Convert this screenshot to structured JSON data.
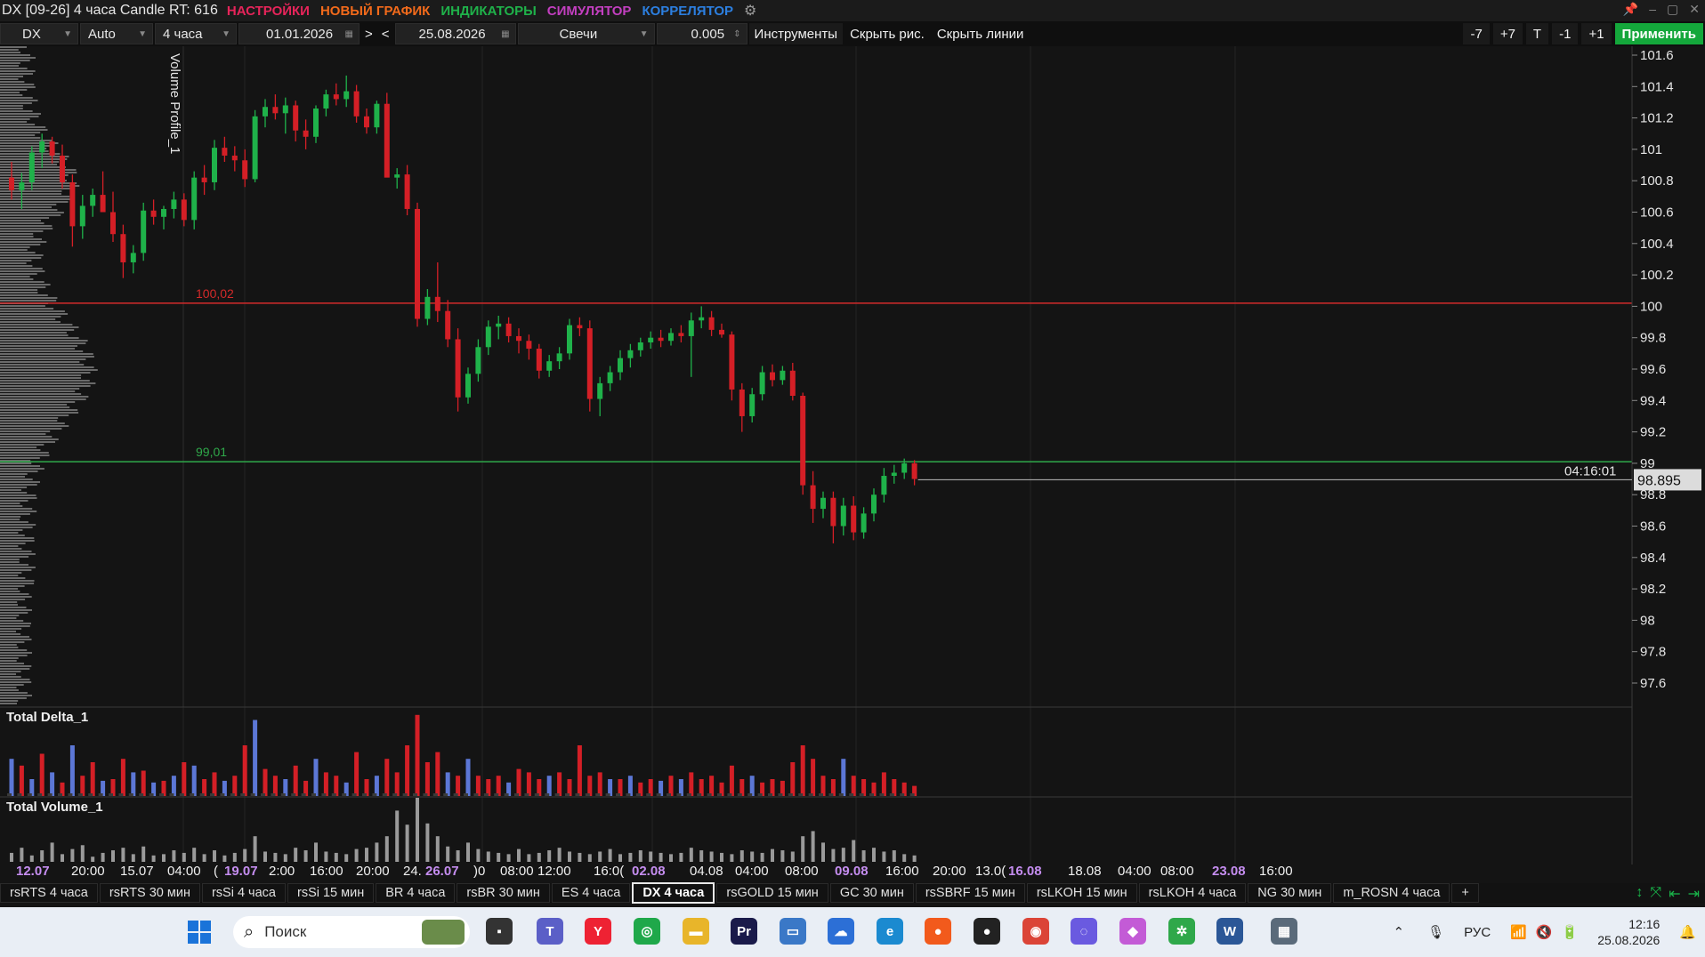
{
  "window": {
    "title": "DX [09-26] 4 часа Candle RT: 616",
    "menu": [
      {
        "label": "НАСТРОЙКИ",
        "color": "#e6245a"
      },
      {
        "label": "НОВЫЙ ГРАФИК",
        "color": "#f26a1b"
      },
      {
        "label": "ИНДИКАТОРЫ",
        "color": "#1fb24a"
      },
      {
        "label": "СИМУЛЯТОР",
        "color": "#c33fc0"
      },
      {
        "label": "КОРРЕЛЯТОР",
        "color": "#2c7fe0"
      }
    ]
  },
  "toolbar": {
    "symbol": "DX",
    "scale": "Auto",
    "timeframe": "4 часа",
    "date_from": "01.01.2026",
    "nav_next": ">",
    "nav_prev": "<",
    "date_to": "25.08.2026",
    "chart_type": "Свечи",
    "step": "0.005",
    "tools": "Инструменты",
    "hide_drawings": "Скрыть рис.",
    "hide_lines": "Скрыть линии",
    "right_buttons": [
      "-7",
      "+7",
      "T",
      "-1",
      "+1"
    ],
    "apply": "Применить"
  },
  "chart_data": {
    "type": "candlestick",
    "y_ticks": [
      "101.6",
      "101.4",
      "101.2",
      "101",
      "100.8",
      "100.6",
      "100.4",
      "100.2",
      "100",
      "99.8",
      "99.6",
      "99.4",
      "99.2",
      "99",
      "98.8",
      "98.6",
      "98.4",
      "98.2",
      "98",
      "97.8",
      "97.6"
    ],
    "ylim": [
      97.5,
      101.7
    ],
    "x_labels": [
      {
        "text": "12.07",
        "highlight": true
      },
      {
        "text": "20:00"
      },
      {
        "text": "15.07"
      },
      {
        "text": "04:00"
      },
      {
        "text": "("
      },
      {
        "text": "19.07",
        "highlight": true
      },
      {
        "text": "2:00"
      },
      {
        "text": "16:00"
      },
      {
        "text": "20:00"
      },
      {
        "text": "24."
      },
      {
        "text": "26.07",
        "highlight": true
      },
      {
        "text": ")0"
      },
      {
        "text": "08:00"
      },
      {
        "text": "12:00"
      },
      {
        "text": "16:0("
      },
      {
        "text": "02.08",
        "highlight": true
      },
      {
        "text": "04.08"
      },
      {
        "text": "04:00"
      },
      {
        "text": "08:00"
      },
      {
        "text": "09.08",
        "highlight": true
      },
      {
        "text": "16:00"
      },
      {
        "text": "20:00"
      },
      {
        "text": "13.0("
      },
      {
        "text": "16.08",
        "highlight": true
      },
      {
        "text": "18.08"
      },
      {
        "text": "04:00"
      },
      {
        "text": "08:00"
      },
      {
        "text": "23.08",
        "highlight": true
      },
      {
        "text": "16:00"
      }
    ],
    "levels": [
      {
        "label": "100,02",
        "price": 100.02,
        "color": "#d42a2a"
      },
      {
        "label": "99,01",
        "price": 99.01,
        "color": "#2fa84a"
      }
    ],
    "last_price": "98.895",
    "last_value": 98.895,
    "countdown": "04:16:01",
    "panels": {
      "volume_profile": "Volume Profile_1",
      "delta": "Total Delta_1",
      "volume": "Total Volume_1"
    },
    "colors": {
      "up": "#1fb24a",
      "down": "#d41f26",
      "delta_pos": "#5c77d6",
      "delta_neg": "#d41f26",
      "volume": "#9a9a9a"
    },
    "candles": [
      [
        100.82,
        100.92,
        100.68,
        100.74
      ],
      [
        100.74,
        100.85,
        100.62,
        100.79
      ],
      [
        100.79,
        101.02,
        100.74,
        100.98
      ],
      [
        100.98,
        101.1,
        100.88,
        101.05
      ],
      [
        101.05,
        101.08,
        100.91,
        100.96
      ],
      [
        100.96,
        101.03,
        100.75,
        100.79
      ],
      [
        100.79,
        100.84,
        100.38,
        100.51
      ],
      [
        100.51,
        100.71,
        100.43,
        100.64
      ],
      [
        100.64,
        100.75,
        100.57,
        100.71
      ],
      [
        100.71,
        100.86,
        100.64,
        100.6
      ],
      [
        100.6,
        100.73,
        100.41,
        100.46
      ],
      [
        100.46,
        100.52,
        100.18,
        100.28
      ],
      [
        100.28,
        100.39,
        100.21,
        100.34
      ],
      [
        100.34,
        100.66,
        100.29,
        100.61
      ],
      [
        100.61,
        100.68,
        100.52,
        100.57
      ],
      [
        100.57,
        100.64,
        100.49,
        100.62
      ],
      [
        100.62,
        100.73,
        100.56,
        100.68
      ],
      [
        100.68,
        100.72,
        100.51,
        100.55
      ],
      [
        100.55,
        100.86,
        100.49,
        100.82
      ],
      [
        100.82,
        100.9,
        100.71,
        100.79
      ],
      [
        100.79,
        101.06,
        100.74,
        101.01
      ],
      [
        101.01,
        101.08,
        100.92,
        100.96
      ],
      [
        100.96,
        101.02,
        100.86,
        100.93
      ],
      [
        100.93,
        101.0,
        100.76,
        100.81
      ],
      [
        100.81,
        101.25,
        100.79,
        101.21
      ],
      [
        101.21,
        101.32,
        101.14,
        101.27
      ],
      [
        101.27,
        101.35,
        101.19,
        101.23
      ],
      [
        101.23,
        101.33,
        101.1,
        101.28
      ],
      [
        101.28,
        101.31,
        101.05,
        101.12
      ],
      [
        101.12,
        101.19,
        101.0,
        101.08
      ],
      [
        101.08,
        101.28,
        101.04,
        101.26
      ],
      [
        101.26,
        101.38,
        101.21,
        101.35
      ],
      [
        101.35,
        101.42,
        101.28,
        101.32
      ],
      [
        101.32,
        101.47,
        101.27,
        101.37
      ],
      [
        101.37,
        101.41,
        101.17,
        101.21
      ],
      [
        101.21,
        101.26,
        101.1,
        101.14
      ],
      [
        101.14,
        101.31,
        101.1,
        101.29
      ],
      [
        101.29,
        101.36,
        101.03,
        100.82
      ],
      [
        100.82,
        100.88,
        100.75,
        100.84
      ],
      [
        100.84,
        100.9,
        100.58,
        100.62
      ],
      [
        100.62,
        100.66,
        99.87,
        99.92
      ],
      [
        99.92,
        100.11,
        99.88,
        100.06
      ],
      [
        100.06,
        100.28,
        99.9,
        99.97
      ],
      [
        99.97,
        100.04,
        99.74,
        99.79
      ],
      [
        99.79,
        99.86,
        99.33,
        99.42
      ],
      [
        99.42,
        99.61,
        99.38,
        99.57
      ],
      [
        99.57,
        99.79,
        99.52,
        99.74
      ],
      [
        99.74,
        99.91,
        99.69,
        99.87
      ],
      [
        99.87,
        99.94,
        99.79,
        99.89
      ],
      [
        99.89,
        99.93,
        99.77,
        99.81
      ],
      [
        99.81,
        99.86,
        99.7,
        99.78
      ],
      [
        99.78,
        99.82,
        99.66,
        99.73
      ],
      [
        99.73,
        99.76,
        99.54,
        99.59
      ],
      [
        99.59,
        99.69,
        99.55,
        99.65
      ],
      [
        99.65,
        99.74,
        99.6,
        99.7
      ],
      [
        99.7,
        99.92,
        99.66,
        99.88
      ],
      [
        99.88,
        99.93,
        99.81,
        99.86
      ],
      [
        99.86,
        99.91,
        99.33,
        99.41
      ],
      [
        99.41,
        99.55,
        99.3,
        99.51
      ],
      [
        99.51,
        99.62,
        99.46,
        99.58
      ],
      [
        99.58,
        99.72,
        99.53,
        99.67
      ],
      [
        99.67,
        99.76,
        99.61,
        99.72
      ],
      [
        99.72,
        99.8,
        99.68,
        99.77
      ],
      [
        99.77,
        99.84,
        99.73,
        99.8
      ],
      [
        99.8,
        99.85,
        99.74,
        99.78
      ],
      [
        99.78,
        99.86,
        99.75,
        99.83
      ],
      [
        99.83,
        99.88,
        99.77,
        99.81
      ],
      [
        99.81,
        99.96,
        99.55,
        99.91
      ],
      [
        99.91,
        100.0,
        99.86,
        99.93
      ],
      [
        99.93,
        99.97,
        99.81,
        99.85
      ],
      [
        99.85,
        99.89,
        99.8,
        99.82
      ],
      [
        99.82,
        99.84,
        99.4,
        99.47
      ],
      [
        99.47,
        99.51,
        99.2,
        99.3
      ],
      [
        99.3,
        99.48,
        99.26,
        99.44
      ],
      [
        99.44,
        99.62,
        99.4,
        99.58
      ],
      [
        99.58,
        99.63,
        99.49,
        99.53
      ],
      [
        99.53,
        99.62,
        99.5,
        99.59
      ],
      [
        99.59,
        99.64,
        99.4,
        99.43
      ],
      [
        99.43,
        99.45,
        98.8,
        98.86
      ],
      [
        98.86,
        98.95,
        98.62,
        98.71
      ],
      [
        98.71,
        98.82,
        98.65,
        98.78
      ],
      [
        98.78,
        98.82,
        98.49,
        98.6
      ],
      [
        98.6,
        98.78,
        98.54,
        98.73
      ],
      [
        98.73,
        98.79,
        98.51,
        98.56
      ],
      [
        98.56,
        98.72,
        98.52,
        98.68
      ],
      [
        98.68,
        98.84,
        98.63,
        98.8
      ],
      [
        98.8,
        98.97,
        98.75,
        98.92
      ],
      [
        98.92,
        98.99,
        98.87,
        98.94
      ],
      [
        98.94,
        99.03,
        98.9,
        99.0
      ],
      [
        99.0,
        99.02,
        98.86,
        98.9
      ]
    ],
    "delta": [
      22,
      -18,
      10,
      -25,
      14,
      -8,
      30,
      -12,
      -20,
      9,
      -10,
      -22,
      14,
      -15,
      8,
      -9,
      12,
      -20,
      18,
      -10,
      -14,
      9,
      -12,
      -30,
      45,
      -16,
      -12,
      10,
      -18,
      -9,
      22,
      -14,
      -12,
      8,
      -26,
      -10,
      12,
      -22,
      -14,
      -30,
      -48,
      -20,
      -26,
      14,
      -12,
      22,
      -12,
      -10,
      -12,
      8,
      -16,
      -14,
      -10,
      12,
      -14,
      -10,
      -30,
      -12,
      -14,
      10,
      -10,
      12,
      -8,
      -10,
      9,
      -12,
      10,
      -14,
      -10,
      -12,
      -8,
      -18,
      -10,
      12,
      -8,
      -10,
      -9,
      -20,
      -30,
      -22,
      -12,
      -10,
      22,
      -12,
      -10,
      -8,
      -14,
      -10,
      -8,
      -6
    ],
    "volume": [
      14,
      22,
      10,
      18,
      30,
      12,
      20,
      26,
      8,
      14,
      18,
      22,
      12,
      24,
      10,
      12,
      18,
      14,
      22,
      12,
      18,
      10,
      14,
      20,
      40,
      16,
      14,
      12,
      22,
      18,
      30,
      16,
      14,
      12,
      20,
      22,
      30,
      40,
      80,
      58,
      100,
      60,
      40,
      24,
      18,
      30,
      20,
      16,
      14,
      12,
      20,
      12,
      14,
      18,
      22,
      16,
      14,
      12,
      16,
      20,
      12,
      14,
      18,
      16,
      14,
      12,
      14,
      22,
      18,
      16,
      14,
      12,
      18,
      16,
      14,
      20,
      18,
      16,
      40,
      48,
      30,
      20,
      22,
      34,
      18,
      22,
      16,
      18,
      12,
      10
    ]
  },
  "tabs": [
    {
      "label": "rsRTS 4 часа"
    },
    {
      "label": "rsRTS 30 мин"
    },
    {
      "label": "rsSi 4 часа"
    },
    {
      "label": "rsSi 15 мин"
    },
    {
      "label": "BR 4 часа"
    },
    {
      "label": "rsBR 30 мин"
    },
    {
      "label": "ES 4 часа"
    },
    {
      "label": "DX 4 часа",
      "active": true
    },
    {
      "label": "rsGOLD 15 мин"
    },
    {
      "label": "GC 30 мин"
    },
    {
      "label": "rsSBRF 15 мин"
    },
    {
      "label": "rsLKOH 15 мин"
    },
    {
      "label": "rsLKOH 4 часа"
    },
    {
      "label": "NG 30 мин"
    },
    {
      "label": "m_ROSN 4 часа"
    },
    {
      "label": "+"
    }
  ],
  "taskbar": {
    "search_placeholder": "Поиск",
    "apps": [
      {
        "name": "file-explorer-icon",
        "glyph": "▪",
        "color": "#333"
      },
      {
        "name": "teams-icon",
        "glyph": "T",
        "color": "#5b5fc7"
      },
      {
        "name": "yandex-browser-icon",
        "glyph": "Y",
        "color": "#e23"
      },
      {
        "name": "green-circle-app-icon",
        "glyph": "◎",
        "color": "#1fa84a"
      },
      {
        "name": "folder-icon",
        "glyph": "▬",
        "color": "#e8b52a"
      },
      {
        "name": "premiere-icon",
        "glyph": "Pr",
        "color": "#1a1a4a"
      },
      {
        "name": "monitor-app-icon",
        "glyph": "▭",
        "color": "#3a78c7"
      },
      {
        "name": "cloud-app-icon",
        "glyph": "☁",
        "color": "#2c6fd6"
      },
      {
        "name": "edge-icon",
        "glyph": "e",
        "color": "#1b8ad0"
      },
      {
        "name": "firefox-icon",
        "glyph": "●",
        "color": "#f25a1c"
      },
      {
        "name": "obs-icon",
        "glyph": "●",
        "color": "#222"
      },
      {
        "name": "chrome-icon",
        "glyph": "◉",
        "color": "#db4437"
      },
      {
        "name": "messenger-icon",
        "glyph": "◌",
        "color": "#6a5ae0"
      },
      {
        "name": "shape-app-icon",
        "glyph": "◆",
        "color": "#c35bd6"
      },
      {
        "name": "settings-gear-icon",
        "glyph": "✲",
        "color": "#2fa84a"
      },
      {
        "name": "word-icon",
        "glyph": "W",
        "color": "#2b5797"
      },
      {
        "name": "calculator-icon",
        "glyph": "▦",
        "color": "#5a6a7a"
      }
    ],
    "language": "РУС",
    "time": "12:16",
    "date": "25.08.2026"
  }
}
